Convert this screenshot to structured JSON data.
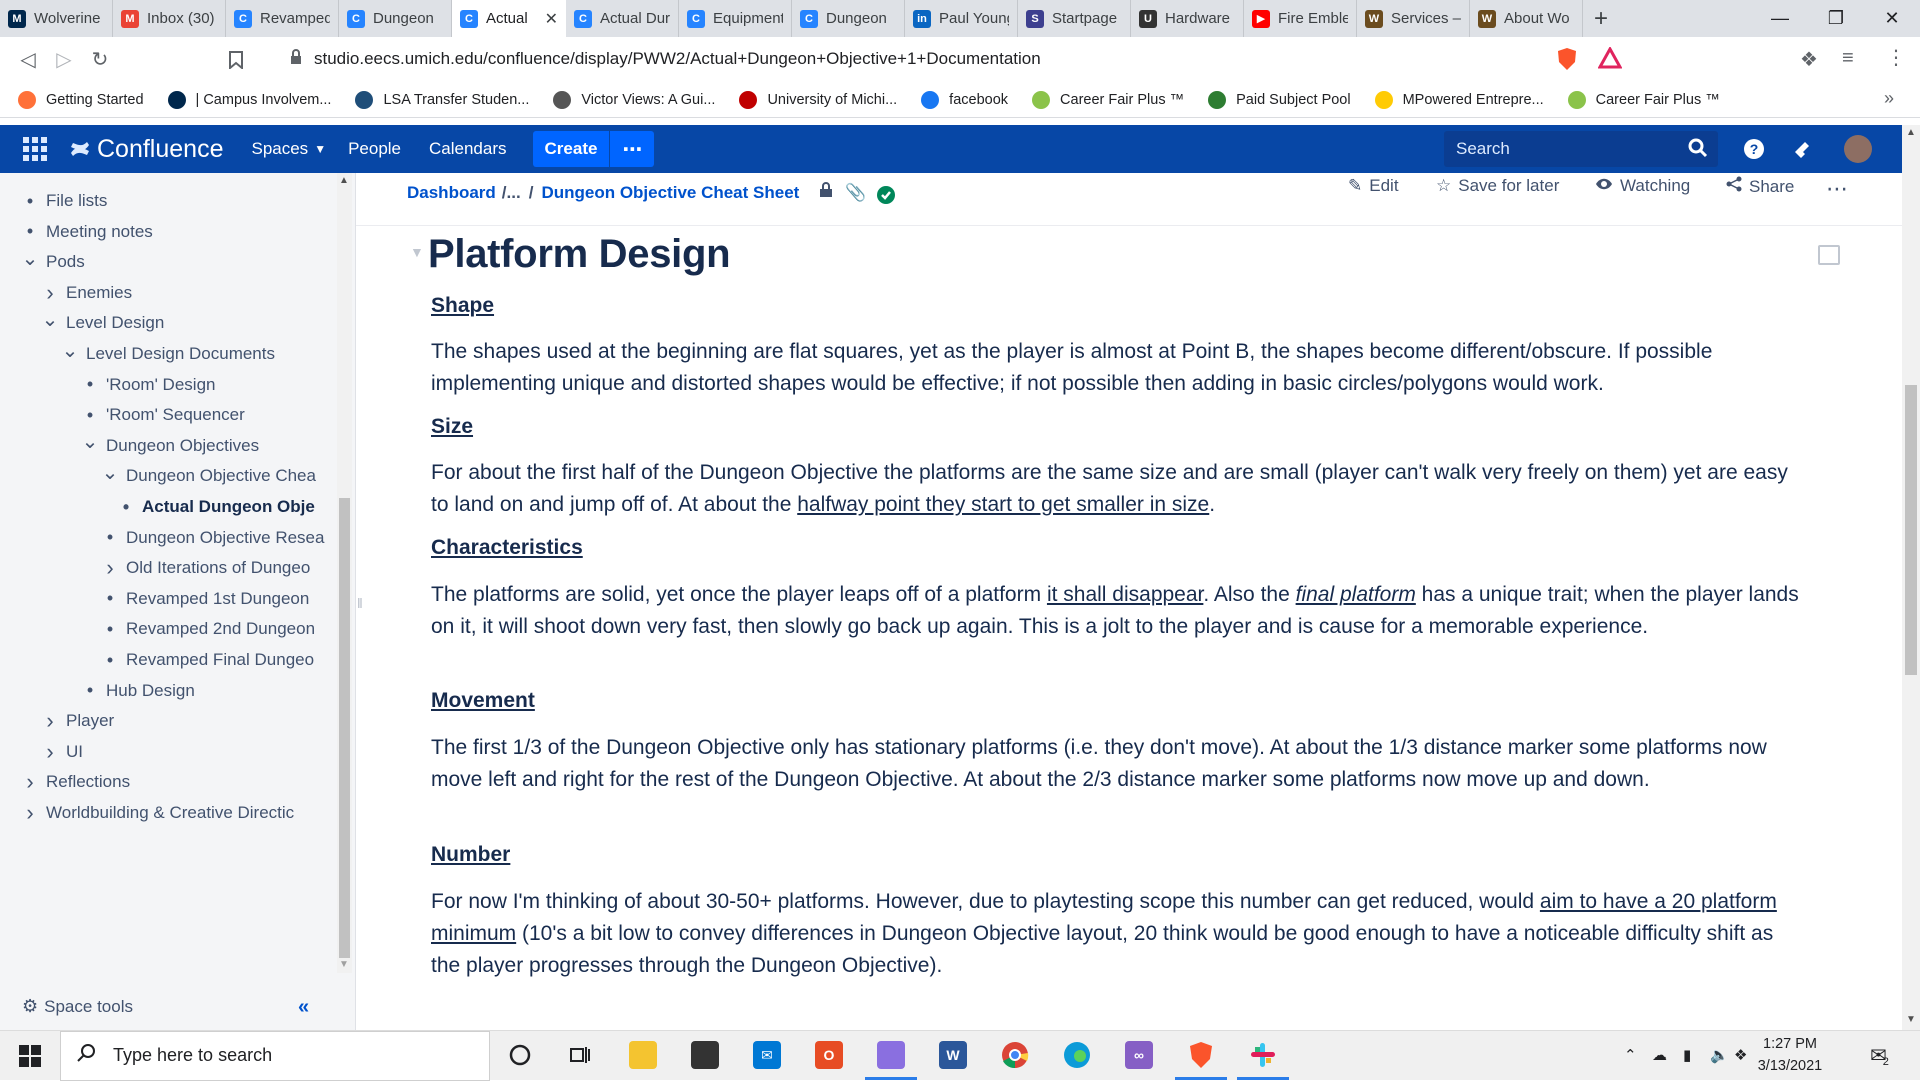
{
  "browser": {
    "tabs": [
      {
        "label": "Wolverine",
        "fav": "M",
        "color": "#00274c"
      },
      {
        "label": "Inbox (30)",
        "fav": "M",
        "color": "#ea4335"
      },
      {
        "label": "Revamped",
        "fav": "C",
        "color": "#2684ff"
      },
      {
        "label": "Dungeon",
        "fav": "C",
        "color": "#2684ff"
      },
      {
        "label": "Actual",
        "fav": "C",
        "color": "#2684ff",
        "active": true
      },
      {
        "label": "Actual Dur",
        "fav": "C",
        "color": "#2684ff"
      },
      {
        "label": "Equipment",
        "fav": "C",
        "color": "#2684ff"
      },
      {
        "label": "Dungeon",
        "fav": "C",
        "color": "#2684ff"
      },
      {
        "label": "Paul Young",
        "fav": "in",
        "color": "#0a66c2"
      },
      {
        "label": "Startpage",
        "fav": "S",
        "color": "#3d3f8f"
      },
      {
        "label": "Hardware",
        "fav": "U",
        "color": "#333333"
      },
      {
        "label": "Fire Emble",
        "fav": "▶",
        "color": "#ff0000"
      },
      {
        "label": "Services –",
        "fav": "W",
        "color": "#6b4c1f"
      },
      {
        "label": "About Wo",
        "fav": "W",
        "color": "#6b4c1f"
      }
    ],
    "url": "studio.eecs.umich.edu/confluence/display/PWW2/Actual+Dungeon+Objective+1+Documentation",
    "bookmarks": [
      {
        "label": "Getting Started",
        "color": "#ff7139"
      },
      {
        "label": "| Campus Involvem...",
        "color": "#00274c"
      },
      {
        "label": "LSA Transfer Studen...",
        "color": "#1f4e79"
      },
      {
        "label": "Victor Views: A Gui...",
        "color": "#555555"
      },
      {
        "label": "University of Michi...",
        "color": "#c00000"
      },
      {
        "label": "facebook",
        "color": "#1877f2"
      },
      {
        "label": "Career Fair Plus ™",
        "color": "#8bc34a"
      },
      {
        "label": "Paid Subject Pool",
        "color": "#2e7d32"
      },
      {
        "label": "MPowered Entrepre...",
        "color": "#ffcb05"
      },
      {
        "label": "Career Fair Plus ™",
        "color": "#8bc34a"
      }
    ]
  },
  "header": {
    "product": "Confluence",
    "nav": [
      "Spaces",
      "People",
      "Calendars"
    ],
    "create_label": "Create",
    "search_placeholder": "Search",
    "brand_color": "#0747a6"
  },
  "sidebar": {
    "items": [
      {
        "label": "File lists",
        "marker": "bullet",
        "depth": 0
      },
      {
        "label": "Meeting notes",
        "marker": "bullet",
        "depth": 0
      },
      {
        "label": "Pods",
        "marker": "open",
        "depth": 0
      },
      {
        "label": "Enemies",
        "marker": "closed",
        "depth": 1
      },
      {
        "label": "Level Design",
        "marker": "open",
        "depth": 1
      },
      {
        "label": "Level Design Documents",
        "marker": "open",
        "depth": 2
      },
      {
        "label": "'Room' Design",
        "marker": "bullet",
        "depth": 3
      },
      {
        "label": "'Room' Sequencer",
        "marker": "bullet",
        "depth": 3
      },
      {
        "label": "Dungeon Objectives",
        "marker": "open",
        "depth": 3
      },
      {
        "label": "Dungeon Objective Chea",
        "marker": "open",
        "depth": 4
      },
      {
        "label": "Actual Dungeon Obje",
        "marker": "bullet",
        "depth": 5,
        "current": true
      },
      {
        "label": "Dungeon Objective Resea",
        "marker": "bullet",
        "depth": 4
      },
      {
        "label": "Old Iterations of Dungeo",
        "marker": "closed",
        "depth": 4
      },
      {
        "label": "Revamped 1st Dungeon",
        "marker": "bullet",
        "depth": 4
      },
      {
        "label": "Revamped 2nd Dungeon",
        "marker": "bullet",
        "depth": 4
      },
      {
        "label": "Revamped Final Dungeo",
        "marker": "bullet",
        "depth": 4
      },
      {
        "label": "Hub Design",
        "marker": "bullet",
        "depth": 3
      },
      {
        "label": "Player",
        "marker": "closed",
        "depth": 1
      },
      {
        "label": "UI",
        "marker": "closed",
        "depth": 1
      },
      {
        "label": "Reflections",
        "marker": "closed",
        "depth": 0
      },
      {
        "label": "Worldbuilding & Creative Directic",
        "marker": "closed",
        "depth": 0
      }
    ],
    "space_tools": "Space tools"
  },
  "breadcrumb": {
    "root": "Dashboard",
    "ellipsis": "/...",
    "sep": "/",
    "parent": "Dungeon Objective Cheat Sheet"
  },
  "page_actions": {
    "edit": "Edit",
    "save": "Save for later",
    "watch": "Watching",
    "share": "Share"
  },
  "page": {
    "heading": "Platform Design",
    "sections": [
      {
        "title": "Shape",
        "parts": [
          {
            "t": "The shapes used at the beginning are flat squares, yet as the player is almost at Point B, the shapes become different/obscure. If possible implementing unique and distorted shapes would be effective; if not possible then adding in basic circles/polygons would work."
          }
        ]
      },
      {
        "title": "Size",
        "parts": [
          {
            "t": "For about the first half of the Dungeon Objective the platforms are the same size and are small (player can't walk very freely on them) yet are easy to land on and jump off of. At about the "
          },
          {
            "t": "halfway point they start to get smaller in size",
            "u": true
          },
          {
            "t": "."
          }
        ]
      },
      {
        "title": "Characteristics",
        "parts": [
          {
            "t": "The platforms are solid, yet once the player leaps off of a platform "
          },
          {
            "t": "it shall disappear",
            "u": true
          },
          {
            "t": ". Also the "
          },
          {
            "t": "final platform",
            "u": true,
            "i": true
          },
          {
            "t": " has a unique trait; when the player lands on it, it will shoot down very fast, then slowly go back up again. This is a jolt to the player and is cause for a memorable experience."
          }
        ]
      },
      {
        "title": "Movement",
        "parts": [
          {
            "t": "The first 1/3 of the Dungeon Objective only has stationary platforms (i.e. they don't move). At about the 1/3 distance marker some platforms now move left and right for the rest of the Dungeon Objective. At about the 2/3 distance marker some platforms now move up and down."
          }
        ]
      },
      {
        "title": "Number",
        "parts": [
          {
            "t": "For now I'm thinking of about 30-50+ platforms. However, due to playtesting scope this number can get reduced, would "
          },
          {
            "t": "aim to have a 20 platform minimum",
            "u": true
          },
          {
            "t": " (10's a bit low to convey differences in Dungeon Objective layout, 20 think would be good enough to have a noticeable difficulty shift as the player progresses through the Dungeon Objective)."
          }
        ]
      }
    ]
  },
  "taskbar": {
    "search_placeholder": "Type here to search",
    "time": "1:27 PM",
    "date": "3/13/2021",
    "notifications": "2"
  }
}
